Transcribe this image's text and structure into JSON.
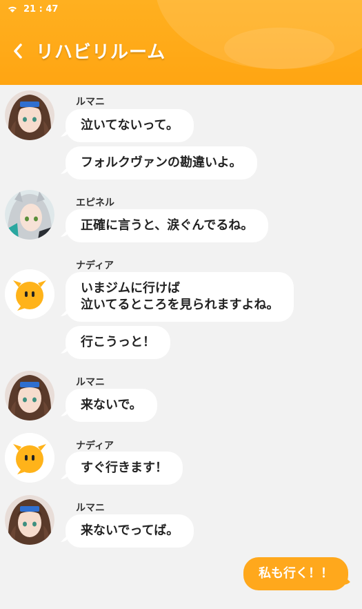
{
  "status_bar": {
    "time": "21 : 47"
  },
  "header": {
    "title": "リハビリルーム"
  },
  "colors": {
    "accent": "#ffa81c",
    "bubble": "#ffffff",
    "background": "#f2f2f2"
  },
  "messages": [
    {
      "sender": "ルマニ",
      "avatar": "avatar-rumani",
      "lines": [
        "泣いてないって。",
        "フォルクヴァンの勘違いよ。"
      ]
    },
    {
      "sender": "エピネル",
      "avatar": "avatar-epinel",
      "lines": [
        "正確に言うと、涙ぐんでるね。"
      ]
    },
    {
      "sender": "ナディア",
      "avatar": "avatar-nadia",
      "lines": [
        "いまジムに行けば\n泣いてるところを見られますよね。",
        "行こうっと！"
      ]
    },
    {
      "sender": "ルマニ",
      "avatar": "avatar-rumani",
      "lines": [
        "来ないで。"
      ]
    },
    {
      "sender": "ナディア",
      "avatar": "avatar-nadia",
      "lines": [
        "すぐ行きます！"
      ]
    },
    {
      "sender": "ルマニ",
      "avatar": "avatar-rumani",
      "lines": [
        "来ないでってば。"
      ]
    }
  ],
  "self_message": "私も行く！！"
}
